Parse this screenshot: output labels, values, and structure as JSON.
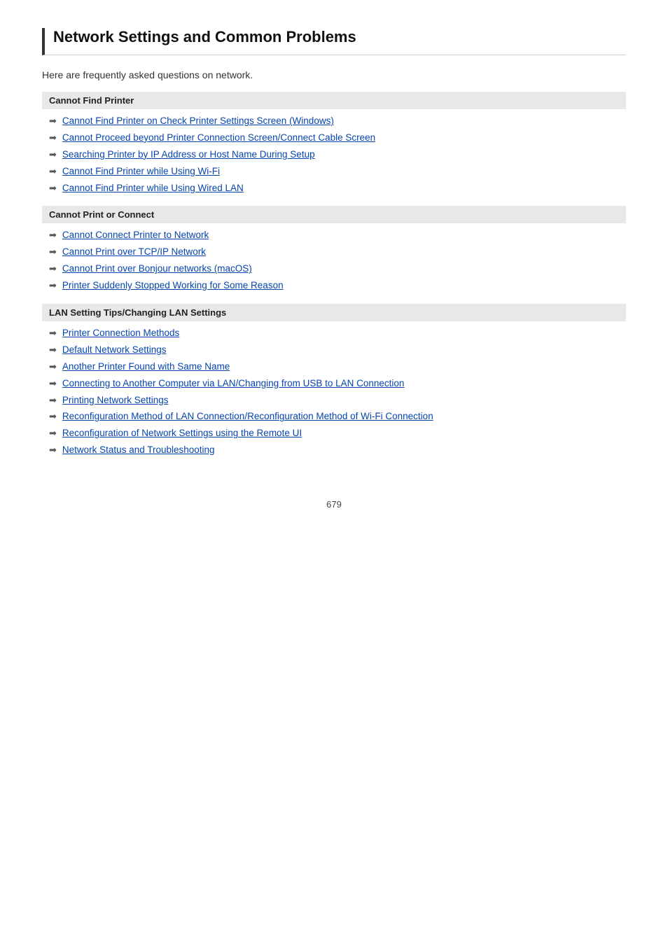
{
  "page": {
    "title": "Network Settings and Common Problems",
    "intro": "Here are frequently asked questions on network.",
    "page_number": "679"
  },
  "sections": [
    {
      "id": "cannot-find-printer",
      "header": "Cannot Find Printer",
      "links": [
        "Cannot Find Printer on Check Printer Settings Screen (Windows)",
        "Cannot Proceed beyond Printer Connection Screen/Connect Cable Screen",
        "Searching Printer by IP Address or Host Name During Setup",
        "Cannot Find Printer while Using Wi-Fi",
        "Cannot Find Printer while Using Wired LAN"
      ]
    },
    {
      "id": "cannot-print-or-connect",
      "header": "Cannot Print or Connect",
      "links": [
        "Cannot Connect Printer to Network",
        "Cannot Print over TCP/IP Network",
        "Cannot Print over Bonjour networks (macOS)",
        "Printer Suddenly Stopped Working for Some Reason"
      ]
    },
    {
      "id": "lan-settings",
      "header": "LAN Setting Tips/Changing LAN Settings",
      "links": [
        "Printer Connection Methods",
        "Default Network Settings",
        "Another Printer Found with Same Name",
        "Connecting to Another Computer via LAN/Changing from USB to LAN Connection",
        "Printing Network Settings",
        "Reconfiguration Method of LAN Connection/Reconfiguration Method of Wi-Fi Connection",
        "Reconfiguration of Network Settings using the Remote UI",
        "Network Status and Troubleshooting"
      ]
    }
  ]
}
